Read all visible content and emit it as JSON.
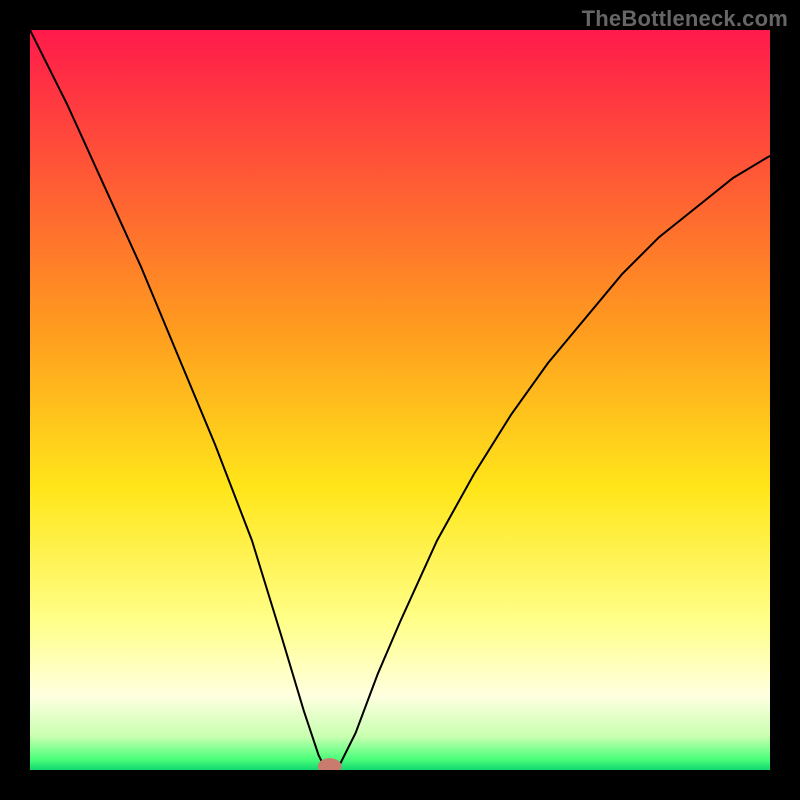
{
  "watermark": "TheBottleneck.com",
  "chart_data": {
    "type": "line",
    "title": "",
    "xlabel": "",
    "ylabel": "",
    "xlim": [
      0,
      100
    ],
    "ylim": [
      0,
      100
    ],
    "gradient_bands": [
      {
        "stop": 0.0,
        "color": "#ff1a4b"
      },
      {
        "stop": 0.4,
        "color": "#ff9a1f"
      },
      {
        "stop": 0.62,
        "color": "#ffe61a"
      },
      {
        "stop": 0.8,
        "color": "#ffff8a"
      },
      {
        "stop": 0.9,
        "color": "#ffffe0"
      },
      {
        "stop": 0.955,
        "color": "#c8ffb0"
      },
      {
        "stop": 0.985,
        "color": "#4cff7a"
      },
      {
        "stop": 1.0,
        "color": "#12d870"
      }
    ],
    "curve_min_x": 40,
    "curve": [
      {
        "x": 0,
        "y": 100
      },
      {
        "x": 5,
        "y": 90
      },
      {
        "x": 10,
        "y": 79
      },
      {
        "x": 15,
        "y": 68
      },
      {
        "x": 20,
        "y": 56
      },
      {
        "x": 25,
        "y": 44
      },
      {
        "x": 30,
        "y": 31
      },
      {
        "x": 34,
        "y": 18
      },
      {
        "x": 37,
        "y": 8
      },
      {
        "x": 39,
        "y": 2
      },
      {
        "x": 40,
        "y": 0
      },
      {
        "x": 41,
        "y": 0
      },
      {
        "x": 42,
        "y": 1
      },
      {
        "x": 44,
        "y": 5
      },
      {
        "x": 47,
        "y": 13
      },
      {
        "x": 50,
        "y": 20
      },
      {
        "x": 55,
        "y": 31
      },
      {
        "x": 60,
        "y": 40
      },
      {
        "x": 65,
        "y": 48
      },
      {
        "x": 70,
        "y": 55
      },
      {
        "x": 75,
        "y": 61
      },
      {
        "x": 80,
        "y": 67
      },
      {
        "x": 85,
        "y": 72
      },
      {
        "x": 90,
        "y": 76
      },
      {
        "x": 95,
        "y": 80
      },
      {
        "x": 100,
        "y": 83
      }
    ],
    "marker": {
      "x": 40.5,
      "y": 0.5,
      "rx": 1.6,
      "ry": 1.1,
      "color": "#c97b6e"
    }
  }
}
